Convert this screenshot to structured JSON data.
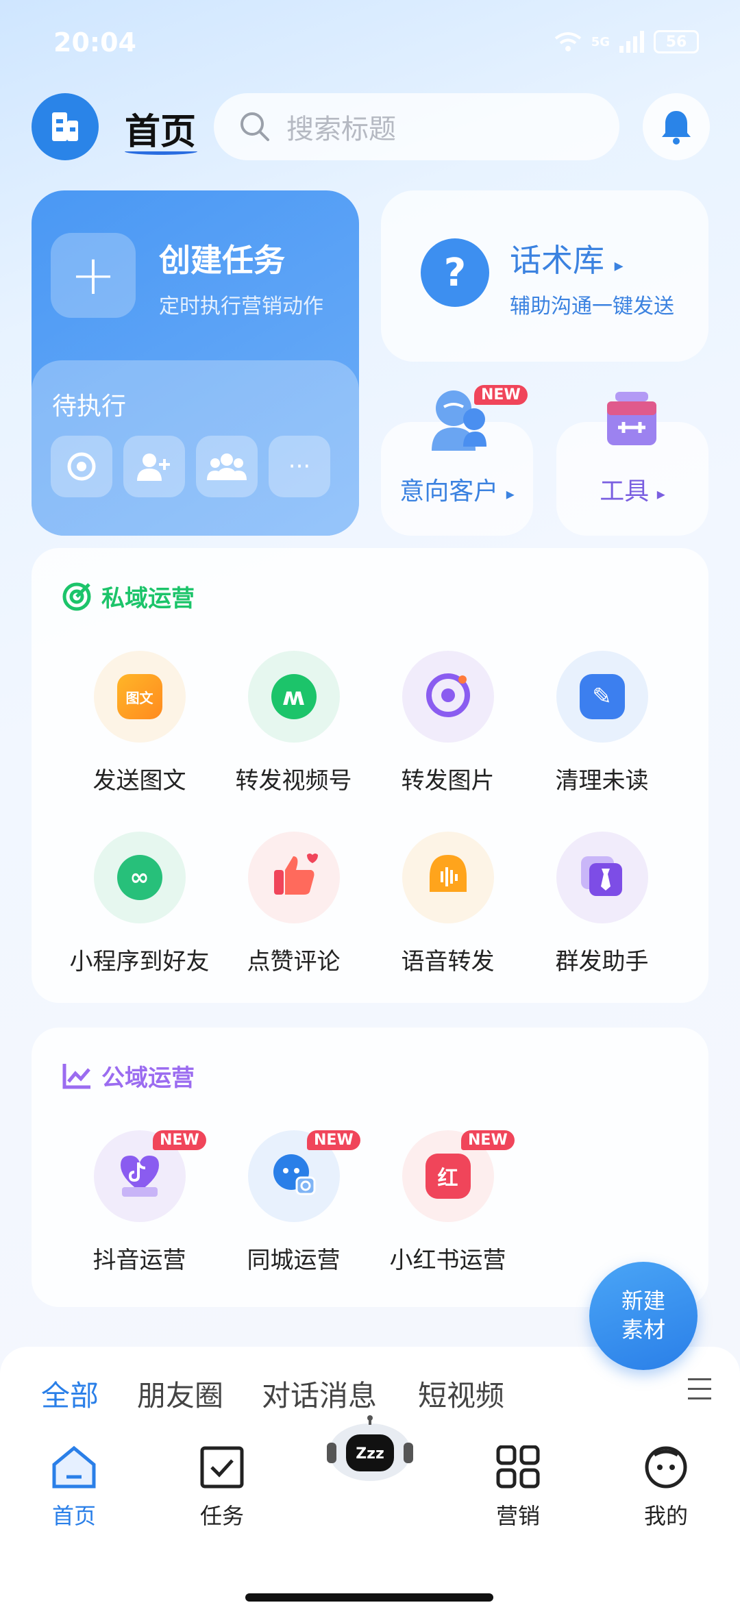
{
  "status_bar": {
    "time": "20:04",
    "network": "5G",
    "battery": "56"
  },
  "header": {
    "title": "首页",
    "search_placeholder": "搜索标题"
  },
  "create_task": {
    "title": "创建任务",
    "subtitle": "定时执行营销动作",
    "pending_label": "待执行",
    "more": "···"
  },
  "script_lib": {
    "title": "话术库",
    "subtitle": "辅助沟通一键发送",
    "icon": "?"
  },
  "intent_customer": {
    "label": "意向客户",
    "badge": "NEW"
  },
  "tools": {
    "label": "工具"
  },
  "private_ops": {
    "title": "私域运营",
    "items": [
      {
        "label": "发送图文",
        "icon_text": "图文"
      },
      {
        "label": "转发视频号"
      },
      {
        "label": "转发图片"
      },
      {
        "label": "清理未读"
      },
      {
        "label": "小程序到好友"
      },
      {
        "label": "点赞评论"
      },
      {
        "label": "语音转发"
      },
      {
        "label": "群发助手"
      }
    ]
  },
  "public_ops": {
    "title": "公域运营",
    "items": [
      {
        "label": "抖音运营",
        "badge": "NEW"
      },
      {
        "label": "同城运营",
        "badge": "NEW"
      },
      {
        "label": "小红书运营",
        "badge": "NEW",
        "icon_text": "红"
      }
    ]
  },
  "fab": {
    "line1": "新建",
    "line2": "素材"
  },
  "feed_tabs": {
    "all": "全部",
    "moments": "朋友圈",
    "chat": "对话消息",
    "video": "短视频"
  },
  "bottom_nav": {
    "home": "首页",
    "tasks": "任务",
    "robot": "Zzz",
    "marketing": "营销",
    "mine": "我的"
  },
  "colors": {
    "accent": "#2a7fe8",
    "private_green": "#1cc46a",
    "public_purple": "#9b6cf0",
    "badge_red": "#f0455a"
  }
}
